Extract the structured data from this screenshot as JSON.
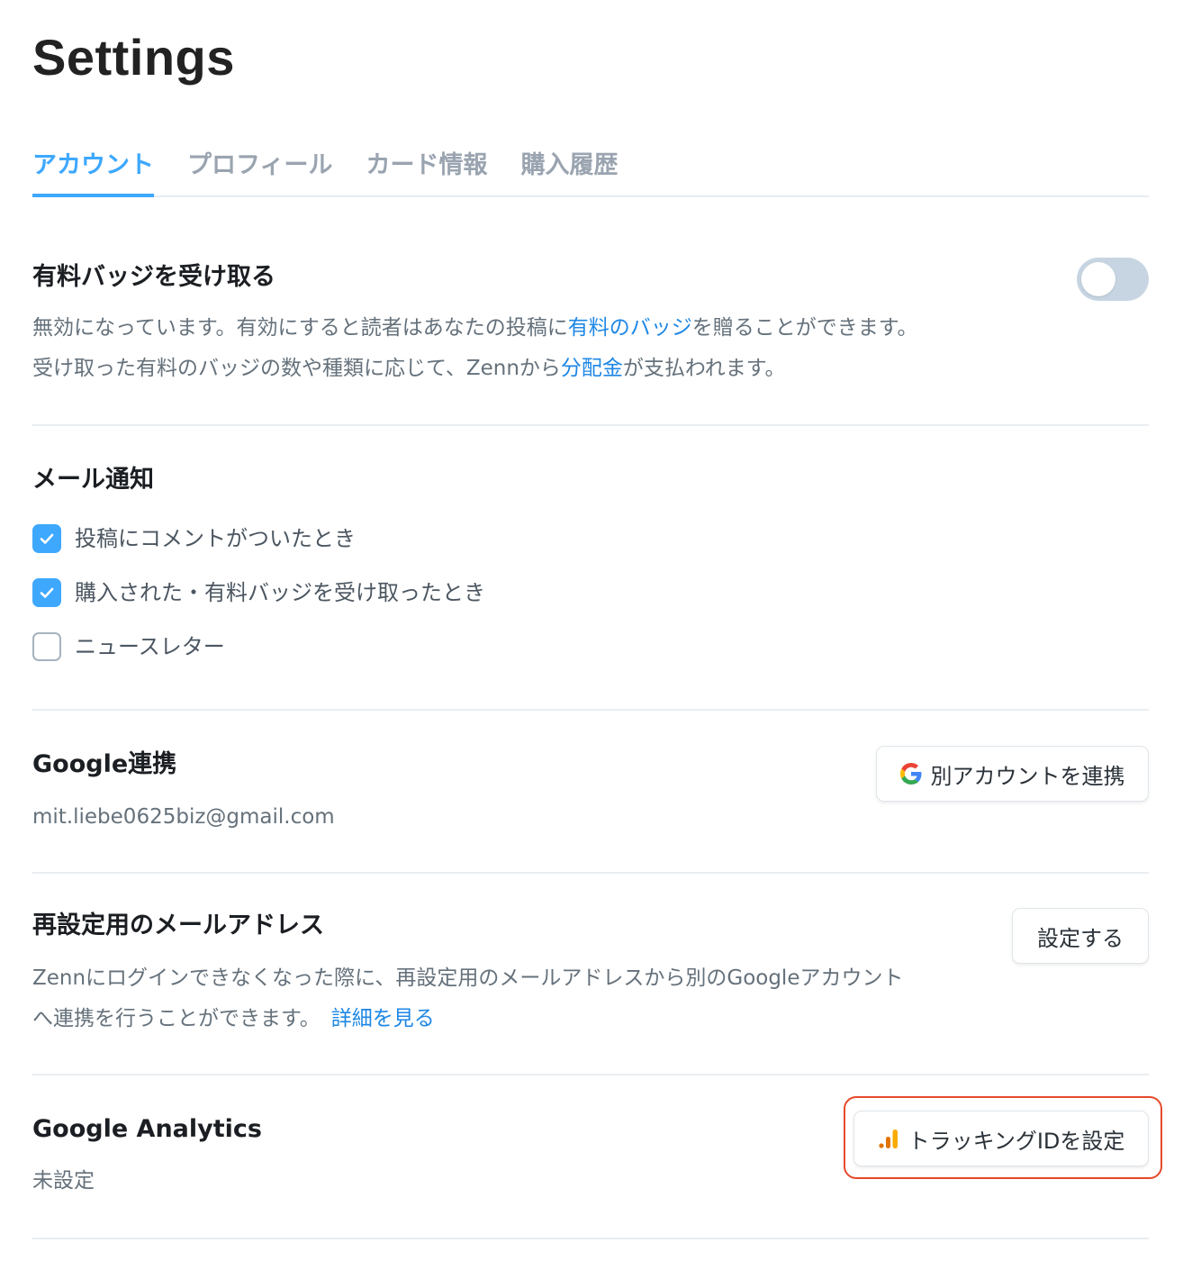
{
  "header": {
    "title": "Settings"
  },
  "tabs": [
    {
      "label": "アカウント",
      "active": true
    },
    {
      "label": "プロフィール",
      "active": false
    },
    {
      "label": "カード情報",
      "active": false
    },
    {
      "label": "購入履歴",
      "active": false
    }
  ],
  "badge": {
    "title": "有料バッジを受け取る",
    "toggle_on": false,
    "desc_line1_a": "無効になっています。有効にすると読者はあなたの投稿に",
    "desc_line1_link": "有料のバッジ",
    "desc_line1_b": "を贈ることができます。",
    "desc_line2_a": "受け取った有料のバッジの数や種類に応じて、Zennから",
    "desc_line2_link": "分配金",
    "desc_line2_b": "が支払われます。"
  },
  "mail": {
    "title": "メール通知",
    "options": [
      {
        "label": "投稿にコメントがついたとき",
        "checked": true
      },
      {
        "label": "購入された・有料バッジを受け取ったとき",
        "checked": true
      },
      {
        "label": "ニュースレター",
        "checked": false
      }
    ]
  },
  "google": {
    "title": "Google連携",
    "email": "mit.liebe0625biz@gmail.com",
    "button_label": "別アカウントを連携"
  },
  "recovery": {
    "title": "再設定用のメールアドレス",
    "desc_line1": "Zennにログインできなくなった際に、再設定用のメールアドレスから別のGoogleアカウント",
    "desc_line2": "へ連携を行うことができます。",
    "link": "詳細を見る",
    "button_label": "設定する"
  },
  "analytics": {
    "title": "Google Analytics",
    "status": "未設定",
    "button_label": "トラッキングIDを設定"
  },
  "colors": {
    "accent": "#3ea8ff",
    "link": "#1e87e5",
    "highlight": "#e54a2a",
    "toggle_off": "#c7d5e2"
  }
}
